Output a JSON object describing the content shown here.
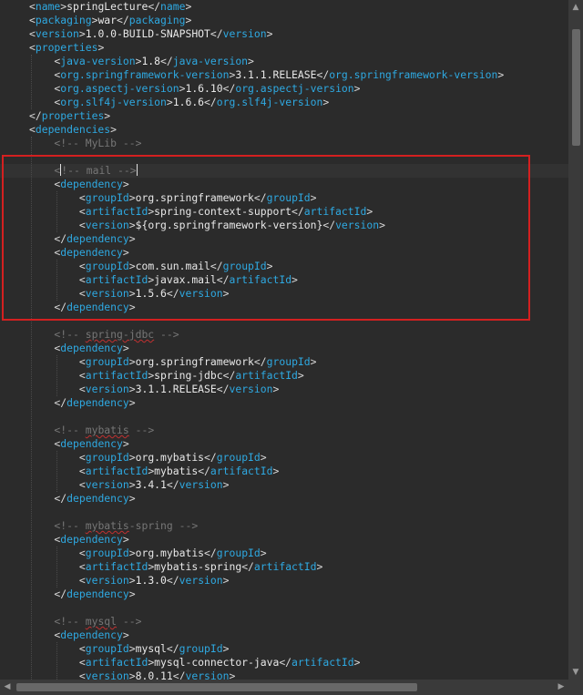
{
  "lines": [
    {
      "segs": [
        [
          "br",
          "<"
        ],
        [
          "tag",
          "name"
        ],
        [
          "br",
          ">"
        ],
        [
          "txt",
          "springLecture"
        ],
        [
          "br",
          "</"
        ],
        [
          "tag",
          "name"
        ],
        [
          "br",
          ">"
        ]
      ]
    },
    {
      "segs": [
        [
          "br",
          "<"
        ],
        [
          "tag",
          "packaging"
        ],
        [
          "br",
          ">"
        ],
        [
          "txt",
          "war"
        ],
        [
          "br",
          "</"
        ],
        [
          "tag",
          "packaging"
        ],
        [
          "br",
          ">"
        ]
      ]
    },
    {
      "segs": [
        [
          "br",
          "<"
        ],
        [
          "tag",
          "version"
        ],
        [
          "br",
          ">"
        ],
        [
          "txt",
          "1.0.0-BUILD-SNAPSHOT"
        ],
        [
          "br",
          "</"
        ],
        [
          "tag",
          "version"
        ],
        [
          "br",
          ">"
        ]
      ]
    },
    {
      "segs": [
        [
          "br",
          "<"
        ],
        [
          "tag",
          "properties"
        ],
        [
          "br",
          ">"
        ]
      ]
    },
    {
      "segs": [
        [
          "br",
          "    <"
        ],
        [
          "tag",
          "java-version"
        ],
        [
          "br",
          ">"
        ],
        [
          "txt",
          "1.8"
        ],
        [
          "br",
          "</"
        ],
        [
          "tag",
          "java-version"
        ],
        [
          "br",
          ">"
        ]
      ]
    },
    {
      "segs": [
        [
          "br",
          "    <"
        ],
        [
          "tag",
          "org.springframework-version"
        ],
        [
          "br",
          ">"
        ],
        [
          "txt",
          "3.1.1.RELEASE"
        ],
        [
          "br",
          "</"
        ],
        [
          "tag",
          "org.springframework-version"
        ],
        [
          "br",
          ">"
        ]
      ]
    },
    {
      "segs": [
        [
          "br",
          "    <"
        ],
        [
          "tag",
          "org.aspectj-version"
        ],
        [
          "br",
          ">"
        ],
        [
          "txt",
          "1.6.10"
        ],
        [
          "br",
          "</"
        ],
        [
          "tag",
          "org.aspectj-version"
        ],
        [
          "br",
          ">"
        ]
      ]
    },
    {
      "segs": [
        [
          "br",
          "    <"
        ],
        [
          "tag",
          "org.slf4j-version"
        ],
        [
          "br",
          ">"
        ],
        [
          "txt",
          "1.6.6"
        ],
        [
          "br",
          "</"
        ],
        [
          "tag",
          "org.slf4j-version"
        ],
        [
          "br",
          ">"
        ]
      ]
    },
    {
      "segs": [
        [
          "br",
          "</"
        ],
        [
          "tag",
          "properties"
        ],
        [
          "br",
          ">"
        ]
      ]
    },
    {
      "segs": [
        [
          "br",
          "<"
        ],
        [
          "tag",
          "dependencies"
        ],
        [
          "br",
          ">"
        ]
      ]
    },
    {
      "segs": [
        [
          "cmt",
          "    <!-- MyLib -->"
        ]
      ]
    },
    {
      "segs": []
    },
    {
      "segs": [
        [
          "cmt",
          "    <"
        ],
        [
          "caret",
          ""
        ],
        [
          "cmt",
          "!-- mail -->"
        ],
        [
          "caret",
          ""
        ]
      ]
    },
    {
      "segs": [
        [
          "br",
          "    <"
        ],
        [
          "tag",
          "dependency"
        ],
        [
          "br",
          ">"
        ]
      ]
    },
    {
      "segs": [
        [
          "br",
          "        <"
        ],
        [
          "tag",
          "groupId"
        ],
        [
          "br",
          ">"
        ],
        [
          "txt",
          "org.springframework"
        ],
        [
          "br",
          "</"
        ],
        [
          "tag",
          "groupId"
        ],
        [
          "br",
          ">"
        ]
      ]
    },
    {
      "segs": [
        [
          "br",
          "        <"
        ],
        [
          "tag",
          "artifactId"
        ],
        [
          "br",
          ">"
        ],
        [
          "txt",
          "spring-context-support"
        ],
        [
          "br",
          "</"
        ],
        [
          "tag",
          "artifactId"
        ],
        [
          "br",
          ">"
        ]
      ]
    },
    {
      "segs": [
        [
          "br",
          "        <"
        ],
        [
          "tag",
          "version"
        ],
        [
          "br",
          ">"
        ],
        [
          "txt",
          "${org.springframework-version}"
        ],
        [
          "br",
          "</"
        ],
        [
          "tag",
          "version"
        ],
        [
          "br",
          ">"
        ]
      ]
    },
    {
      "segs": [
        [
          "br",
          "    </"
        ],
        [
          "tag",
          "dependency"
        ],
        [
          "br",
          ">"
        ]
      ]
    },
    {
      "segs": [
        [
          "br",
          "    <"
        ],
        [
          "tag",
          "dependency"
        ],
        [
          "br",
          ">"
        ]
      ]
    },
    {
      "segs": [
        [
          "br",
          "        <"
        ],
        [
          "tag",
          "groupId"
        ],
        [
          "br",
          ">"
        ],
        [
          "txt",
          "com.sun.mail"
        ],
        [
          "br",
          "</"
        ],
        [
          "tag",
          "groupId"
        ],
        [
          "br",
          ">"
        ]
      ]
    },
    {
      "segs": [
        [
          "br",
          "        <"
        ],
        [
          "tag",
          "artifactId"
        ],
        [
          "br",
          ">"
        ],
        [
          "txt",
          "javax.mail"
        ],
        [
          "br",
          "</"
        ],
        [
          "tag",
          "artifactId"
        ],
        [
          "br",
          ">"
        ]
      ]
    },
    {
      "segs": [
        [
          "br",
          "        <"
        ],
        [
          "tag",
          "version"
        ],
        [
          "br",
          ">"
        ],
        [
          "txt",
          "1.5.6"
        ],
        [
          "br",
          "</"
        ],
        [
          "tag",
          "version"
        ],
        [
          "br",
          ">"
        ]
      ]
    },
    {
      "segs": [
        [
          "br",
          "    </"
        ],
        [
          "tag",
          "dependency"
        ],
        [
          "br",
          ">"
        ]
      ]
    },
    {
      "segs": []
    },
    {
      "segs": [
        [
          "cmt",
          "    <!-- "
        ],
        [
          "cmtsq",
          "spring-jdbc"
        ],
        [
          "cmt",
          " -->"
        ]
      ]
    },
    {
      "segs": [
        [
          "br",
          "    <"
        ],
        [
          "tag",
          "dependency"
        ],
        [
          "br",
          ">"
        ]
      ]
    },
    {
      "segs": [
        [
          "br",
          "        <"
        ],
        [
          "tag",
          "groupId"
        ],
        [
          "br",
          ">"
        ],
        [
          "txt",
          "org.springframework"
        ],
        [
          "br",
          "</"
        ],
        [
          "tag",
          "groupId"
        ],
        [
          "br",
          ">"
        ]
      ]
    },
    {
      "segs": [
        [
          "br",
          "        <"
        ],
        [
          "tag",
          "artifactId"
        ],
        [
          "br",
          ">"
        ],
        [
          "txt",
          "spring-jdbc"
        ],
        [
          "br",
          "</"
        ],
        [
          "tag",
          "artifactId"
        ],
        [
          "br",
          ">"
        ]
      ]
    },
    {
      "segs": [
        [
          "br",
          "        <"
        ],
        [
          "tag",
          "version"
        ],
        [
          "br",
          ">"
        ],
        [
          "txt",
          "3.1.1.RELEASE"
        ],
        [
          "br",
          "</"
        ],
        [
          "tag",
          "version"
        ],
        [
          "br",
          ">"
        ]
      ]
    },
    {
      "segs": [
        [
          "br",
          "    </"
        ],
        [
          "tag",
          "dependency"
        ],
        [
          "br",
          ">"
        ]
      ]
    },
    {
      "segs": []
    },
    {
      "segs": [
        [
          "cmt",
          "    <!-- "
        ],
        [
          "cmtsq",
          "mybatis"
        ],
        [
          "cmt",
          " -->"
        ]
      ]
    },
    {
      "segs": [
        [
          "br",
          "    <"
        ],
        [
          "tag",
          "dependency"
        ],
        [
          "br",
          ">"
        ]
      ]
    },
    {
      "segs": [
        [
          "br",
          "        <"
        ],
        [
          "tag",
          "groupId"
        ],
        [
          "br",
          ">"
        ],
        [
          "txt",
          "org.mybatis"
        ],
        [
          "br",
          "</"
        ],
        [
          "tag",
          "groupId"
        ],
        [
          "br",
          ">"
        ]
      ]
    },
    {
      "segs": [
        [
          "br",
          "        <"
        ],
        [
          "tag",
          "artifactId"
        ],
        [
          "br",
          ">"
        ],
        [
          "txt",
          "mybatis"
        ],
        [
          "br",
          "</"
        ],
        [
          "tag",
          "artifactId"
        ],
        [
          "br",
          ">"
        ]
      ]
    },
    {
      "segs": [
        [
          "br",
          "        <"
        ],
        [
          "tag",
          "version"
        ],
        [
          "br",
          ">"
        ],
        [
          "txt",
          "3.4.1"
        ],
        [
          "br",
          "</"
        ],
        [
          "tag",
          "version"
        ],
        [
          "br",
          ">"
        ]
      ]
    },
    {
      "segs": [
        [
          "br",
          "    </"
        ],
        [
          "tag",
          "dependency"
        ],
        [
          "br",
          ">"
        ]
      ]
    },
    {
      "segs": []
    },
    {
      "segs": [
        [
          "cmt",
          "    <!-- "
        ],
        [
          "cmtsq",
          "mybatis"
        ],
        [
          "cmt",
          "-spring -->"
        ]
      ]
    },
    {
      "segs": [
        [
          "br",
          "    <"
        ],
        [
          "tag",
          "dependency"
        ],
        [
          "br",
          ">"
        ]
      ]
    },
    {
      "segs": [
        [
          "br",
          "        <"
        ],
        [
          "tag",
          "groupId"
        ],
        [
          "br",
          ">"
        ],
        [
          "txt",
          "org.mybatis"
        ],
        [
          "br",
          "</"
        ],
        [
          "tag",
          "groupId"
        ],
        [
          "br",
          ">"
        ]
      ]
    },
    {
      "segs": [
        [
          "br",
          "        <"
        ],
        [
          "tag",
          "artifactId"
        ],
        [
          "br",
          ">"
        ],
        [
          "txt",
          "mybatis-spring"
        ],
        [
          "br",
          "</"
        ],
        [
          "tag",
          "artifactId"
        ],
        [
          "br",
          ">"
        ]
      ]
    },
    {
      "segs": [
        [
          "br",
          "        <"
        ],
        [
          "tag",
          "version"
        ],
        [
          "br",
          ">"
        ],
        [
          "txt",
          "1.3.0"
        ],
        [
          "br",
          "</"
        ],
        [
          "tag",
          "version"
        ],
        [
          "br",
          ">"
        ]
      ]
    },
    {
      "segs": [
        [
          "br",
          "    </"
        ],
        [
          "tag",
          "dependency"
        ],
        [
          "br",
          ">"
        ]
      ]
    },
    {
      "segs": []
    },
    {
      "segs": [
        [
          "cmt",
          "    <!-- "
        ],
        [
          "cmtsq",
          "mysql"
        ],
        [
          "cmt",
          " -->"
        ]
      ]
    },
    {
      "segs": [
        [
          "br",
          "    <"
        ],
        [
          "tag",
          "dependency"
        ],
        [
          "br",
          ">"
        ]
      ]
    },
    {
      "segs": [
        [
          "br",
          "        <"
        ],
        [
          "tag",
          "groupId"
        ],
        [
          "br",
          ">"
        ],
        [
          "txt",
          "mysql"
        ],
        [
          "br",
          "</"
        ],
        [
          "tag",
          "groupId"
        ],
        [
          "br",
          ">"
        ]
      ]
    },
    {
      "segs": [
        [
          "br",
          "        <"
        ],
        [
          "tag",
          "artifactId"
        ],
        [
          "br",
          ">"
        ],
        [
          "txt",
          "mysql-connector-java"
        ],
        [
          "br",
          "</"
        ],
        [
          "tag",
          "artifactId"
        ],
        [
          "br",
          ">"
        ]
      ]
    },
    {
      "segs": [
        [
          "br",
          "        <"
        ],
        [
          "tag",
          "version"
        ],
        [
          "br",
          ">"
        ],
        [
          "txt",
          "8.0.11"
        ],
        [
          "br",
          "</"
        ],
        [
          "tag",
          "version"
        ],
        [
          "br",
          ">"
        ]
      ]
    }
  ],
  "scrollbars": {
    "up_arrow": "▲",
    "down_arrow": "▼",
    "left_arrow": "◀",
    "right_arrow": "▶"
  }
}
